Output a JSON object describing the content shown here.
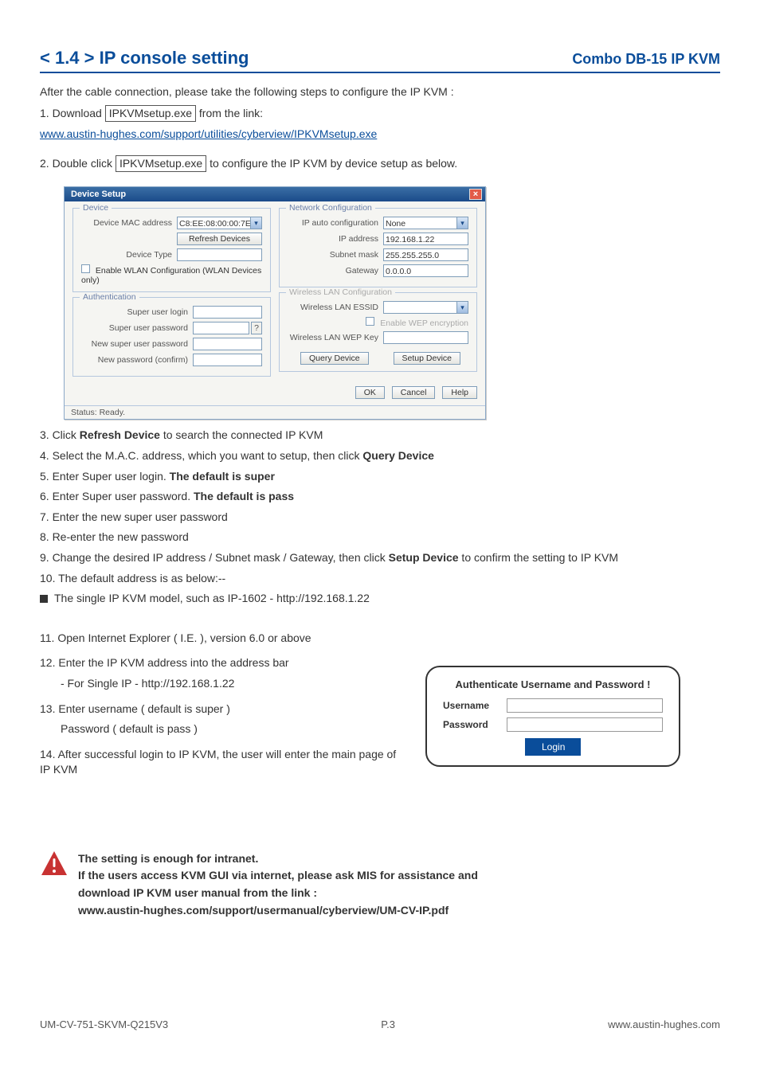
{
  "header": {
    "section": "< 1.4 > IP console setting",
    "product": "Combo  DB-15 IP KVM"
  },
  "intro": "After the cable connection, please take the following steps to configure the IP KVM :",
  "step1_pre": "1.  Download",
  "step1_box": "IPKVMsetup.exe",
  "step1_post": " from the link:",
  "step1_url": "www.austin-hughes.com/support/utilities/cyberview/IPKVMsetup.exe",
  "step2_pre": "2.  Double click",
  "step2_box": "IPKVMsetup.exe",
  "step2_post": " to configure the IP KVM by device setup as below.",
  "dialog": {
    "title": "Device Setup",
    "device": {
      "legend": "Device",
      "mac_lbl": "Device MAC address",
      "mac_val": "C8:EE:08:00:00:7E",
      "refresh_btn": "Refresh Devices",
      "type_lbl": "Device Type",
      "wlan_chk": "Enable WLAN Configuration (WLAN Devices only)"
    },
    "net": {
      "legend": "Network Configuration",
      "ipauto_lbl": "IP auto configuration",
      "ipauto_val": "None",
      "ip_lbl": "IP address",
      "ip_val": "192.168.1.22",
      "mask_lbl": "Subnet mask",
      "mask_val": "255.255.255.0",
      "gw_lbl": "Gateway",
      "gw_val": "0.0.0.0"
    },
    "auth": {
      "legend": "Authentication",
      "login_lbl": "Super user login",
      "pass_lbl": "Super user password",
      "newpass_lbl": "New super user password",
      "confirm_lbl": "New password (confirm)"
    },
    "wlan": {
      "legend": "Wireless LAN Configuration",
      "essid_lbl": "Wireless LAN ESSID",
      "wep_chk": "Enable WEP encryption",
      "wepkey_lbl": "Wireless LAN WEP Key",
      "query_btn": "Query Device",
      "setup_btn": "Setup Device"
    },
    "btns": {
      "ok": "OK",
      "cancel": "Cancel",
      "help": "Help"
    },
    "status": "Status: Ready."
  },
  "steps3_10": {
    "s3_a": "3.  Click ",
    "s3_b": "Refresh Device",
    "s3_c": " to search the connected IP KVM",
    "s4_a": "4.  Select the M.A.C. address, which you want to setup, then click ",
    "s4_b": "Query Device",
    "s5_a": "5.  Enter Super user login.  ",
    "s5_b": "The default is super",
    "s6_a": "6.  Enter Super user password.  ",
    "s6_b": "The default is pass",
    "s7": "7.  Enter the new super user password",
    "s8": "8.  Re-enter the new password",
    "s9_a": "9.  Change the desired IP address / Subnet mask / Gateway, then click ",
    "s9_b": "Setup Device",
    "s9_c": " to confirm the setting to IP KVM",
    "s10": "10. The default address is as below:--",
    "s10b": "The single IP KVM model, such as IP-1602        - http://192.168.1.22"
  },
  "steps11_14": {
    "s11": "11. Open Internet Explorer ( I.E. ), version 6.0 or above",
    "s12a": "12. Enter the IP KVM address into the address bar",
    "s12b": "- For Single IP - http://192.168.1.22",
    "s13a": "13. Enter username ( default is super )",
    "s13b": "Password ( default is pass )",
    "s14": "14. After successful login to IP KVM, the user will enter the main page of IP KVM"
  },
  "login": {
    "title": "Authenticate Username and Password !",
    "user_lbl": "Username",
    "pass_lbl": "Password",
    "btn": "Login"
  },
  "warning": {
    "l1": "The setting is enough for intranet.",
    "l2": "If the users access KVM GUI via internet, please ask MIS for assistance and",
    "l3": "download IP KVM user manual from the link :",
    "l4": "www.austin-hughes.com/support/usermanual/cyberview/UM-CV-IP.pdf"
  },
  "footer": {
    "left": "UM-CV-751-SKVM-Q215V3",
    "mid": "P.3",
    "right": "www.austin-hughes.com"
  }
}
